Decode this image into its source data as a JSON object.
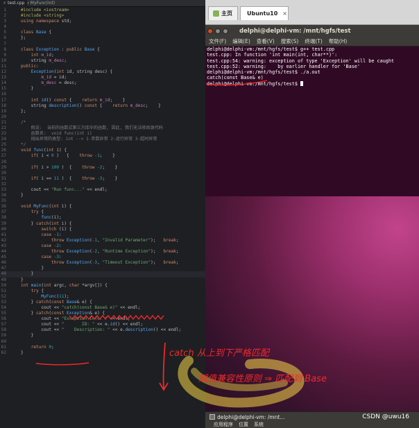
{
  "editor": {
    "tab_label": "test.cpp",
    "tab_close": "×",
    "breadcrumb": "MyFunc(int)",
    "current_line": 48,
    "lines": [
      [
        {
          "c": "pp",
          "t": "#include <iostream>"
        }
      ],
      [
        {
          "c": "pp",
          "t": "#include <string>"
        }
      ],
      [
        {
          "c": "kw",
          "t": "using namespace "
        },
        {
          "c": "",
          "t": "std;"
        }
      ],
      [],
      [
        {
          "c": "kw",
          "t": "class "
        },
        {
          "c": "ty",
          "t": "Base "
        },
        {
          "c": "",
          "t": "{"
        }
      ],
      [
        {
          "c": "",
          "t": "};"
        }
      ],
      [],
      [
        {
          "c": "kw",
          "t": "class "
        },
        {
          "c": "ty",
          "t": "Exception "
        },
        {
          "c": "",
          "t": ": "
        },
        {
          "c": "kw",
          "t": "public "
        },
        {
          "c": "ty",
          "t": "Base "
        },
        {
          "c": "",
          "t": "{"
        }
      ],
      [
        {
          "c": "",
          "t": "    "
        },
        {
          "c": "kw",
          "t": "int "
        },
        {
          "c": "cmz",
          "t": "m_id"
        },
        {
          "c": "",
          "t": ";"
        }
      ],
      [
        {
          "c": "",
          "t": "    string "
        },
        {
          "c": "cmz",
          "t": "m_desc"
        },
        {
          "c": "",
          "t": ";"
        }
      ],
      [
        {
          "c": "kw",
          "t": "public"
        },
        {
          "c": "",
          "t": ":"
        }
      ],
      [
        {
          "c": "",
          "t": "    "
        },
        {
          "c": "fn",
          "t": "Exception"
        },
        {
          "c": "",
          "t": "("
        },
        {
          "c": "kw",
          "t": "int "
        },
        {
          "c": "",
          "t": "id, string desc) {"
        }
      ],
      [
        {
          "c": "",
          "t": "        "
        },
        {
          "c": "cmz",
          "t": "m_id"
        },
        {
          "c": "",
          "t": " = id;"
        }
      ],
      [
        {
          "c": "",
          "t": "        "
        },
        {
          "c": "cmz",
          "t": "m_desc"
        },
        {
          "c": "",
          "t": " = desc;"
        }
      ],
      [
        {
          "c": "",
          "t": "    }"
        }
      ],
      [],
      [
        {
          "c": "",
          "t": "    "
        },
        {
          "c": "kw",
          "t": "int "
        },
        {
          "c": "fn",
          "t": "id"
        },
        {
          "c": "",
          "t": "() "
        },
        {
          "c": "kw",
          "t": "const "
        },
        {
          "c": "",
          "t": "{    "
        },
        {
          "c": "kw",
          "t": "return "
        },
        {
          "c": "cmz",
          "t": "m_id"
        },
        {
          "c": "",
          "t": ";    }"
        }
      ],
      [
        {
          "c": "",
          "t": "    string "
        },
        {
          "c": "fn",
          "t": "description"
        },
        {
          "c": "",
          "t": "() "
        },
        {
          "c": "kw",
          "t": "const "
        },
        {
          "c": "",
          "t": "{    "
        },
        {
          "c": "kw",
          "t": "return "
        },
        {
          "c": "cmz",
          "t": "m_desc"
        },
        {
          "c": "",
          "t": ";    }"
        }
      ],
      [
        {
          "c": "",
          "t": "};"
        }
      ],
      [],
      [
        {
          "c": "cm",
          "t": "/*"
        }
      ],
      [
        {
          "c": "cm",
          "t": "    假设:  当前的函数式第三方库中的函数, 因此, 我们无法修改源代码"
        }
      ],
      [
        {
          "c": "cm",
          "t": "    函数名:  void func(int i)"
        }
      ],
      [
        {
          "c": "cm",
          "t": "    抛出异常的类型: int --> 1-参数异常 2-运行异常 3-超时异常"
        }
      ],
      [
        {
          "c": "cm",
          "t": "*/"
        }
      ],
      [
        {
          "c": "kw",
          "t": "void "
        },
        {
          "c": "fn",
          "t": "func"
        },
        {
          "c": "",
          "t": "("
        },
        {
          "c": "kw",
          "t": "int "
        },
        {
          "c": "",
          "t": "i) {"
        }
      ],
      [
        {
          "c": "",
          "t": "    "
        },
        {
          "c": "kw",
          "t": "if"
        },
        {
          "c": "",
          "t": "( i < "
        },
        {
          "c": "nu",
          "t": "0"
        },
        {
          "c": "",
          "t": " )   {    "
        },
        {
          "c": "kw",
          "t": "throw "
        },
        {
          "c": "nu",
          "t": "-1"
        },
        {
          "c": "",
          "t": ";    }"
        }
      ],
      [],
      [
        {
          "c": "",
          "t": "    "
        },
        {
          "c": "kw",
          "t": "if"
        },
        {
          "c": "",
          "t": "( i > "
        },
        {
          "c": "nu",
          "t": "100"
        },
        {
          "c": "",
          "t": " )  {    "
        },
        {
          "c": "kw",
          "t": "throw "
        },
        {
          "c": "nu",
          "t": "-2"
        },
        {
          "c": "",
          "t": ";    }"
        }
      ],
      [],
      [
        {
          "c": "",
          "t": "    "
        },
        {
          "c": "kw",
          "t": "if"
        },
        {
          "c": "",
          "t": "( i == "
        },
        {
          "c": "nu",
          "t": "11"
        },
        {
          "c": "",
          "t": " )  {    "
        },
        {
          "c": "kw",
          "t": "throw "
        },
        {
          "c": "nu",
          "t": "-3"
        },
        {
          "c": "",
          "t": ";    }"
        }
      ],
      [],
      [
        {
          "c": "",
          "t": "    cout << "
        },
        {
          "c": "st",
          "t": "\"Run func...\""
        },
        {
          "c": "",
          "t": " << endl;"
        }
      ],
      [
        {
          "c": "",
          "t": "}"
        }
      ],
      [],
      [
        {
          "c": "kw",
          "t": "void "
        },
        {
          "c": "fn",
          "t": "MyFunc"
        },
        {
          "c": "",
          "t": "("
        },
        {
          "c": "kw",
          "t": "int "
        },
        {
          "c": "",
          "t": "i) {"
        }
      ],
      [
        {
          "c": "",
          "t": "    "
        },
        {
          "c": "kw",
          "t": "try "
        },
        {
          "c": "",
          "t": "{"
        }
      ],
      [
        {
          "c": "",
          "t": "        "
        },
        {
          "c": "fn",
          "t": "func"
        },
        {
          "c": "",
          "t": "(i);"
        }
      ],
      [
        {
          "c": "",
          "t": "    } "
        },
        {
          "c": "kw",
          "t": "catch"
        },
        {
          "c": "",
          "t": "("
        },
        {
          "c": "kw",
          "t": "int "
        },
        {
          "c": "",
          "t": "i) {"
        }
      ],
      [
        {
          "c": "",
          "t": "        "
        },
        {
          "c": "kw",
          "t": "switch "
        },
        {
          "c": "",
          "t": "(i) {"
        }
      ],
      [
        {
          "c": "",
          "t": "        "
        },
        {
          "c": "kw",
          "t": "case "
        },
        {
          "c": "nu",
          "t": "-1"
        },
        {
          "c": "",
          "t": ":"
        }
      ],
      [
        {
          "c": "",
          "t": "            "
        },
        {
          "c": "kw",
          "t": "throw "
        },
        {
          "c": "fn",
          "t": "Exception"
        },
        {
          "c": "",
          "t": "("
        },
        {
          "c": "nu",
          "t": "-1"
        },
        {
          "c": "",
          "t": ", "
        },
        {
          "c": "st",
          "t": "\"Invalid Parameter\""
        },
        {
          "c": "",
          "t": ");   "
        },
        {
          "c": "kw",
          "t": "break"
        },
        {
          "c": "",
          "t": ";"
        }
      ],
      [
        {
          "c": "",
          "t": "        "
        },
        {
          "c": "kw",
          "t": "case "
        },
        {
          "c": "nu",
          "t": "-2"
        },
        {
          "c": "",
          "t": ":"
        }
      ],
      [
        {
          "c": "",
          "t": "            "
        },
        {
          "c": "kw",
          "t": "throw "
        },
        {
          "c": "fn",
          "t": "Exception"
        },
        {
          "c": "",
          "t": "("
        },
        {
          "c": "nu",
          "t": "-2"
        },
        {
          "c": "",
          "t": ", "
        },
        {
          "c": "st",
          "t": "\"Runtime Exception\""
        },
        {
          "c": "",
          "t": ");   "
        },
        {
          "c": "kw",
          "t": "break"
        },
        {
          "c": "",
          "t": ";"
        }
      ],
      [
        {
          "c": "",
          "t": "        "
        },
        {
          "c": "kw",
          "t": "case "
        },
        {
          "c": "nu",
          "t": "-3"
        },
        {
          "c": "",
          "t": ":"
        }
      ],
      [
        {
          "c": "",
          "t": "            "
        },
        {
          "c": "kw",
          "t": "throw "
        },
        {
          "c": "fn",
          "t": "Exception"
        },
        {
          "c": "",
          "t": "("
        },
        {
          "c": "nu",
          "t": "-3"
        },
        {
          "c": "",
          "t": ", "
        },
        {
          "c": "st",
          "t": "\"Timeout Exception\""
        },
        {
          "c": "",
          "t": ");   "
        },
        {
          "c": "kw",
          "t": "break"
        },
        {
          "c": "",
          "t": ";"
        }
      ],
      [
        {
          "c": "",
          "t": "        }"
        }
      ],
      [
        {
          "c": "",
          "t": "    }"
        }
      ],
      [
        {
          "c": "",
          "t": "}"
        }
      ],
      [
        {
          "c": "kw",
          "t": "int "
        },
        {
          "c": "fn",
          "t": "main"
        },
        {
          "c": "",
          "t": "("
        },
        {
          "c": "kw",
          "t": "int "
        },
        {
          "c": "",
          "t": "argc, "
        },
        {
          "c": "kw",
          "t": "char "
        },
        {
          "c": "",
          "t": "*argv[]) {"
        }
      ],
      [
        {
          "c": "",
          "t": "    "
        },
        {
          "c": "kw",
          "t": "try "
        },
        {
          "c": "",
          "t": "{"
        }
      ],
      [
        {
          "c": "",
          "t": "        "
        },
        {
          "c": "fn",
          "t": "MyFunc"
        },
        {
          "c": "",
          "t": "("
        },
        {
          "c": "nu",
          "t": "11"
        },
        {
          "c": "",
          "t": ");"
        }
      ],
      [
        {
          "c": "",
          "t": "    } "
        },
        {
          "c": "kw",
          "t": "catch"
        },
        {
          "c": "",
          "t": "("
        },
        {
          "c": "kw",
          "t": "const "
        },
        {
          "c": "ty",
          "t": "Base"
        },
        {
          "c": "",
          "t": "& e) {"
        }
      ],
      [
        {
          "c": "",
          "t": "        cout << "
        },
        {
          "c": "st",
          "t": "\"catch(const Base& e)\""
        },
        {
          "c": "",
          "t": " << endl;"
        }
      ],
      [
        {
          "c": "",
          "t": "    } "
        },
        {
          "c": "kw",
          "t": "catch"
        },
        {
          "c": "",
          "t": "("
        },
        {
          "c": "kw",
          "t": "const "
        },
        {
          "c": "ty",
          "t": "Exception"
        },
        {
          "c": "",
          "t": "& e) {"
        }
      ],
      [
        {
          "c": "",
          "t": "        cout << "
        },
        {
          "c": "st",
          "t": "\"Exception Info: \""
        },
        {
          "c": "",
          "t": " << endl;"
        }
      ],
      [
        {
          "c": "",
          "t": "        cout << "
        },
        {
          "c": "st",
          "t": "\"       ID: \""
        },
        {
          "c": "",
          "t": " << e."
        },
        {
          "c": "fn",
          "t": "id"
        },
        {
          "c": "",
          "t": "() << endl;"
        }
      ],
      [
        {
          "c": "",
          "t": "        cout << "
        },
        {
          "c": "st",
          "t": "\"    Description: \""
        },
        {
          "c": "",
          "t": " << e."
        },
        {
          "c": "fn",
          "t": "description"
        },
        {
          "c": "",
          "t": "() << endl;"
        }
      ],
      [
        {
          "c": "",
          "t": "    }"
        }
      ],
      [],
      [
        {
          "c": "",
          "t": "    "
        },
        {
          "c": "kw",
          "t": "return "
        },
        {
          "c": "nu",
          "t": "0"
        },
        {
          "c": "",
          "t": ";"
        }
      ],
      [
        {
          "c": "",
          "t": "}"
        }
      ]
    ]
  },
  "vm": {
    "tab_home": "主页",
    "tab_ubuntu": "Ubuntu10",
    "tab_close": "×",
    "terminal_title": "delphi@delphi-vm: /mnt/hgfs/test",
    "menu": [
      "文件(F)",
      "编辑(E)",
      "查看(V)",
      "搜索(S)",
      "终端(T)",
      "帮助(H)"
    ],
    "terminal_lines": [
      "delphi@delphi-vm:/mnt/hgfs/test$ g++ test.cpp",
      "test.cpp: In function 'int main(int, char**)':",
      "test.cpp:54: warning: exception of type 'Exception' will be caught",
      "test.cpp:52: warning:    by earlier handler for 'Base'",
      "delphi@delphi-vm:/mnt/hgfs/test$ ./a.out",
      "catch(const Base& e)",
      "delphi@delphi-vm:/mnt/hgfs/test$ "
    ],
    "taskbar_window": "delphi@delphi-vm: /mnt...",
    "taskbar_other": "",
    "bottom_menu": [
      "应用程序",
      "位置",
      "系统"
    ]
  },
  "annotations": {
    "line1": "catch 从上到下严格匹配",
    "line2": "赋值兼容性原则 ⇒ 匹配到 Base"
  },
  "watermark": "CSDN @uwu16",
  "colors": {
    "terminal_bg": "#300a24",
    "annotation": "#ee2a2a",
    "highlight": "#f5d547"
  }
}
